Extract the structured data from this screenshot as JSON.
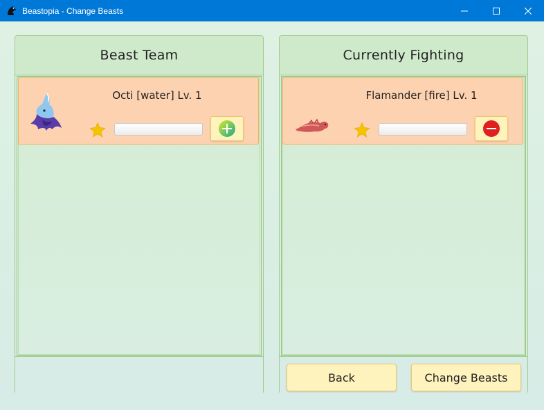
{
  "window": {
    "title": "Beastopia - Change Beasts"
  },
  "team_panel": {
    "title": "Beast Team",
    "beasts": [
      {
        "name": "Octi [water] Lv. 1",
        "sprite": "octi-sprite",
        "favorite_icon": "star-icon",
        "action_icon": "plus-icon",
        "action_color": "#2eb872"
      }
    ]
  },
  "fighting_panel": {
    "title": "Currently Fighting",
    "beasts": [
      {
        "name": "Flamander [fire] Lv. 1",
        "sprite": "flamander-sprite",
        "favorite_icon": "star-icon",
        "action_icon": "minus-icon",
        "action_color": "#e02020"
      }
    ]
  },
  "buttons": {
    "back": "Back",
    "change": "Change Beasts"
  },
  "colors": {
    "titlebar": "#0078d7",
    "card_background": "#fdd2b0",
    "button_background": "#fff3bd",
    "star": "#f5c400"
  }
}
